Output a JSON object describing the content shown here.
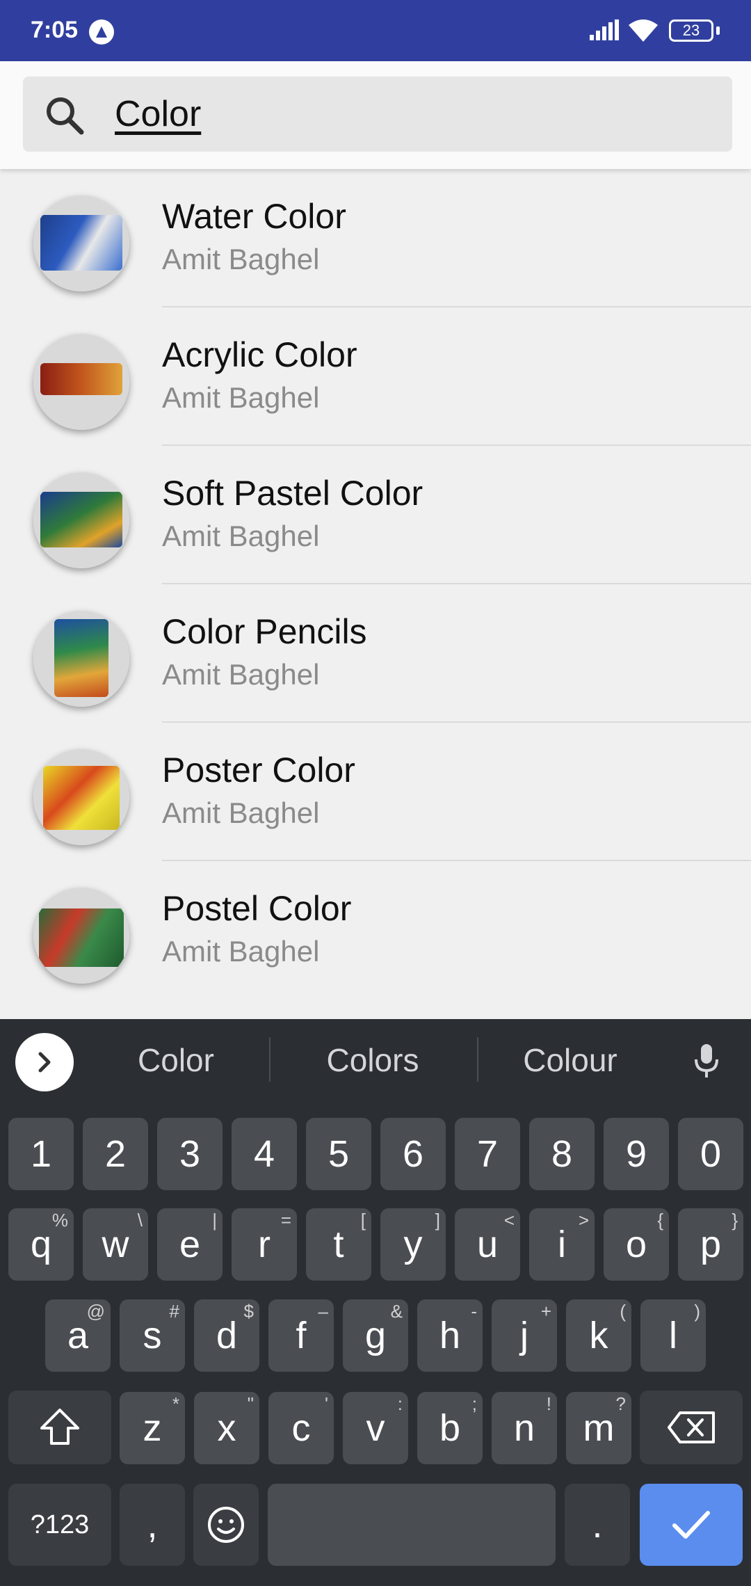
{
  "status_bar": {
    "time": "7:05",
    "battery": "23"
  },
  "search": {
    "query": "Color"
  },
  "results": [
    {
      "title": "Water Color",
      "subtitle": "Amit Baghel"
    },
    {
      "title": "Acrylic Color",
      "subtitle": "Amit Baghel"
    },
    {
      "title": "Soft Pastel Color",
      "subtitle": "Amit Baghel"
    },
    {
      "title": "Color Pencils",
      "subtitle": "Amit Baghel"
    },
    {
      "title": "Poster Color",
      "subtitle": "Amit Baghel"
    },
    {
      "title": "Postel Color",
      "subtitle": "Amit Baghel"
    }
  ],
  "keyboard": {
    "suggestions": [
      "Color",
      "Colors",
      "Colour"
    ],
    "number_row": [
      "1",
      "2",
      "3",
      "4",
      "5",
      "6",
      "7",
      "8",
      "9",
      "0"
    ],
    "row1": [
      {
        "k": "q",
        "h": "%"
      },
      {
        "k": "w",
        "h": "\\"
      },
      {
        "k": "e",
        "h": "|"
      },
      {
        "k": "r",
        "h": "="
      },
      {
        "k": "t",
        "h": "["
      },
      {
        "k": "y",
        "h": "]"
      },
      {
        "k": "u",
        "h": "<"
      },
      {
        "k": "i",
        "h": ">"
      },
      {
        "k": "o",
        "h": "{"
      },
      {
        "k": "p",
        "h": "}"
      }
    ],
    "row2": [
      {
        "k": "a",
        "h": "@"
      },
      {
        "k": "s",
        "h": "#"
      },
      {
        "k": "d",
        "h": "$"
      },
      {
        "k": "f",
        "h": "–"
      },
      {
        "k": "g",
        "h": "&"
      },
      {
        "k": "h",
        "h": "-"
      },
      {
        "k": "j",
        "h": "+"
      },
      {
        "k": "k",
        "h": "("
      },
      {
        "k": "l",
        "h": ")"
      }
    ],
    "row3": [
      {
        "k": "z",
        "h": "*"
      },
      {
        "k": "x",
        "h": "\""
      },
      {
        "k": "c",
        "h": "'"
      },
      {
        "k": "v",
        "h": ":"
      },
      {
        "k": "b",
        "h": ";"
      },
      {
        "k": "n",
        "h": "!"
      },
      {
        "k": "m",
        "h": "?"
      }
    ],
    "symbols_label": "?123",
    "comma": ",",
    "period": "."
  },
  "colors": {
    "status_bar": "#303f9f",
    "keyboard_bg": "#2b2e33",
    "enter_key": "#5b8def"
  }
}
